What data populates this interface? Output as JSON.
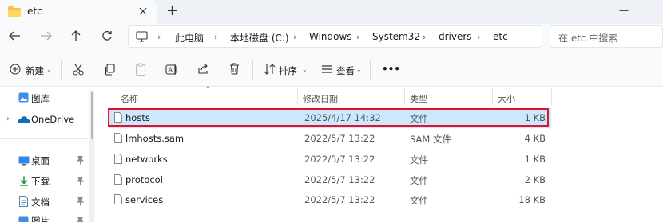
{
  "window": {
    "tab_title": "etc",
    "new_tab": "+"
  },
  "titlebar": {
    "minimize": "—",
    "maximize": "☐"
  },
  "breadcrumb": [
    "此电脑",
    "本地磁盘 (C:)",
    "Windows",
    "System32",
    "drivers",
    "etc"
  ],
  "search": {
    "placeholder": "在 etc 中搜索"
  },
  "toolbar": {
    "new_label": "新建",
    "sort_label": "排序",
    "view_label": "查看",
    "more_label": "•••"
  },
  "sidebar": {
    "gallery": "图库",
    "onedrive": "OneDrive",
    "desktop": "桌面",
    "downloads": "下载",
    "documents": "文档",
    "pictures": "图片"
  },
  "columns": {
    "name": "名称",
    "modified": "修改日期",
    "type": "类型",
    "size": "大小"
  },
  "files": [
    {
      "name": "hosts",
      "modified": "2025/4/17 14:32",
      "type": "文件",
      "size": "1 KB",
      "selected": true
    },
    {
      "name": "lmhosts.sam",
      "modified": "2022/5/7 13:22",
      "type": "SAM 文件",
      "size": "4 KB"
    },
    {
      "name": "networks",
      "modified": "2022/5/7 13:22",
      "type": "文件",
      "size": "1 KB"
    },
    {
      "name": "protocol",
      "modified": "2022/5/7 13:22",
      "type": "文件",
      "size": "2 KB"
    },
    {
      "name": "services",
      "modified": "2022/5/7 13:22",
      "type": "文件",
      "size": "18 KB"
    }
  ],
  "colors": {
    "selection": "#cce8ff",
    "highlight_border": "#e81123",
    "folder": "#f5c14b",
    "onedrive": "#0f6cbd"
  }
}
